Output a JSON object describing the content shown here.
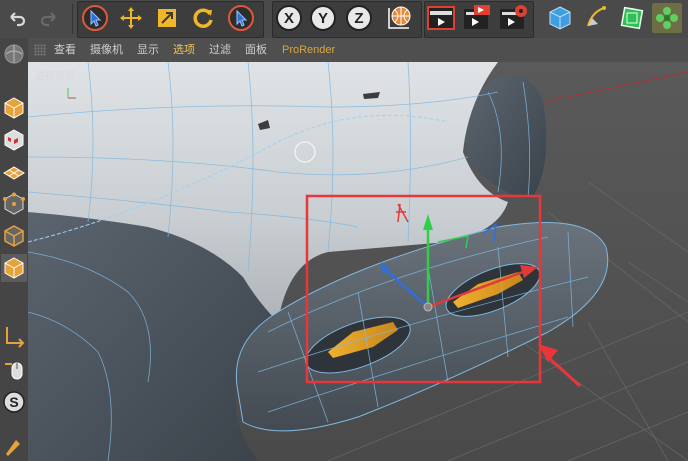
{
  "viewport_menu": {
    "items": [
      {
        "label": "查看"
      },
      {
        "label": "摄像机"
      },
      {
        "label": "显示"
      },
      {
        "label": "选项"
      },
      {
        "label": "过滤"
      },
      {
        "label": "面板"
      },
      {
        "label": "ProRender"
      }
    ],
    "active_index": 3
  },
  "viewport": {
    "view_label": "透视视图"
  },
  "toolbar": {
    "axis_x": "X",
    "axis_y": "Y",
    "axis_z": "Z"
  },
  "colors": {
    "highlight_box": "#e8363b",
    "active_menu": "#f2c75c",
    "selection_edge": "#6fb4e8",
    "selected_face": "#e0a020"
  }
}
